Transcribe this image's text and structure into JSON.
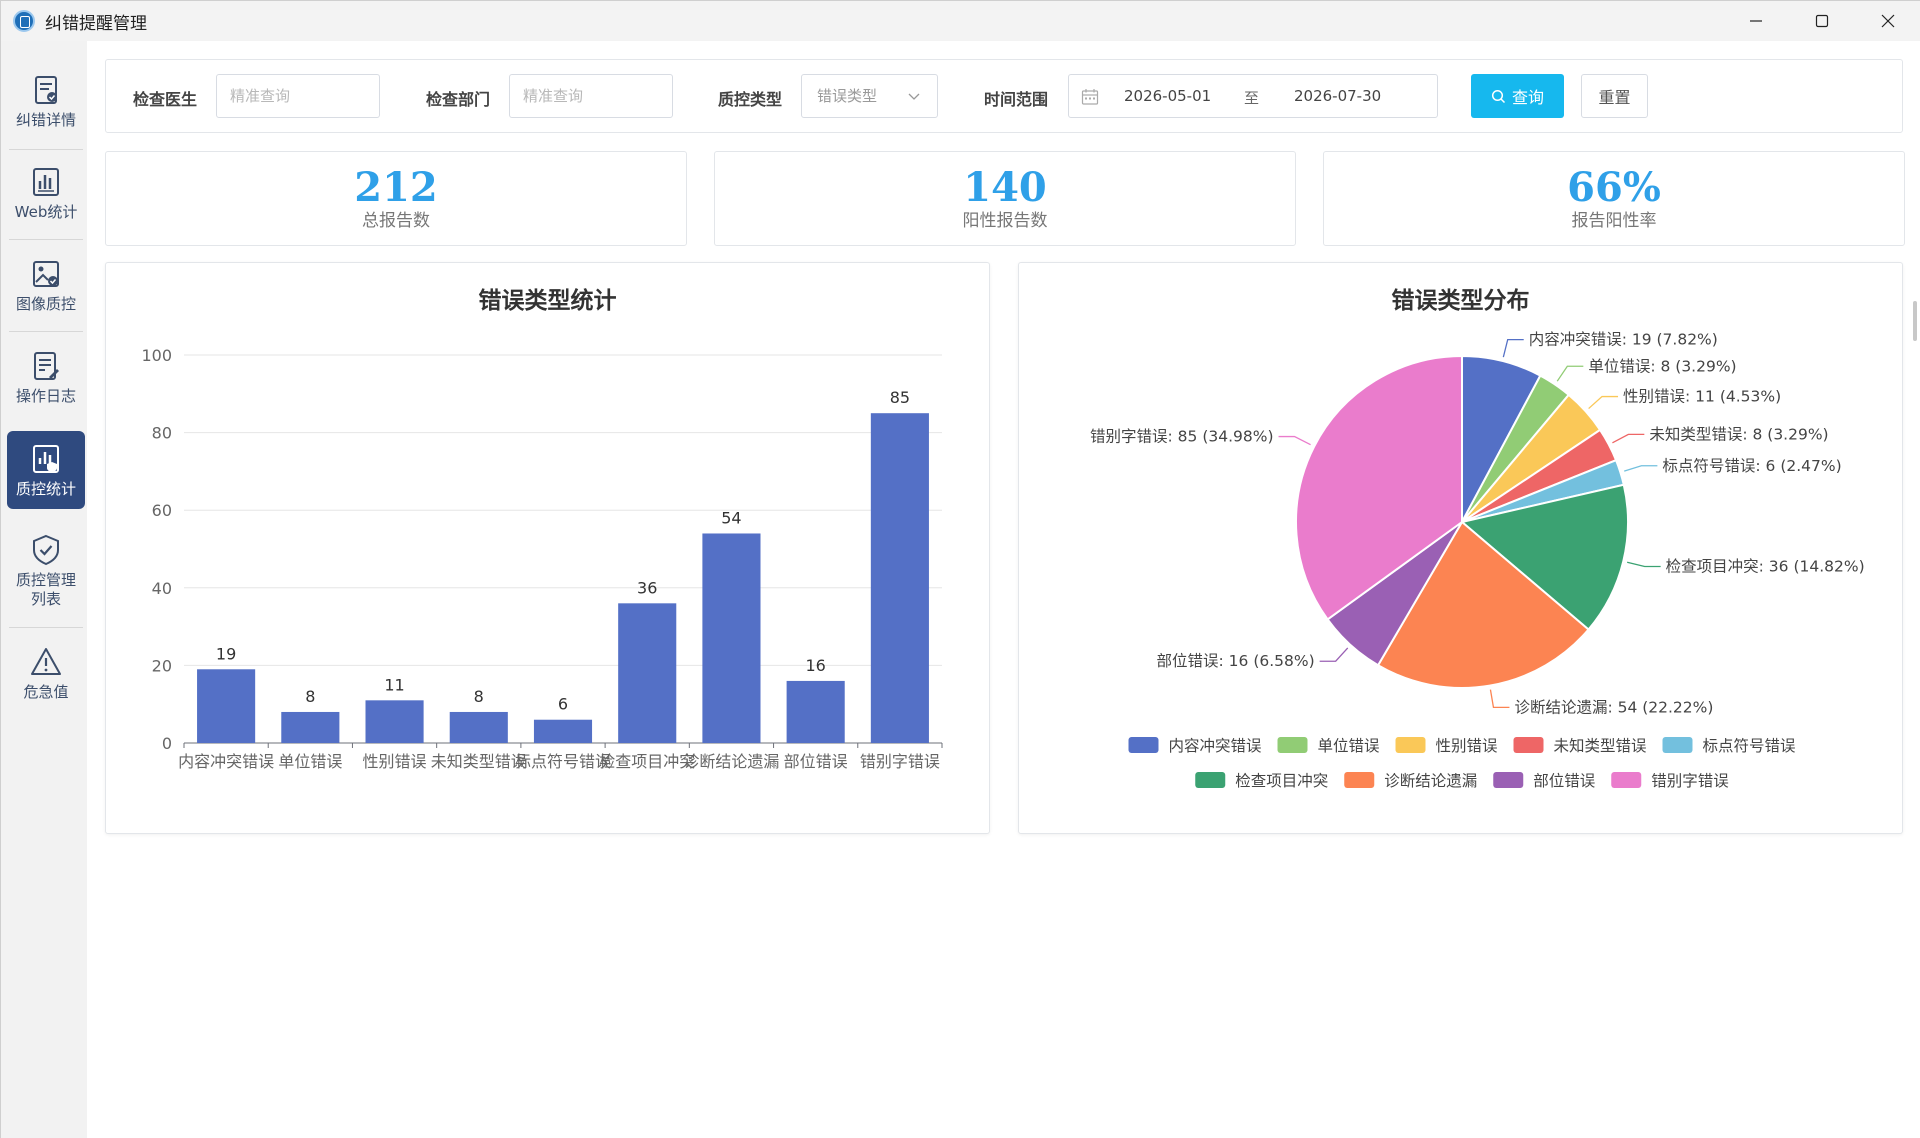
{
  "window": {
    "title": "纠错提醒管理"
  },
  "sidebar": {
    "items": [
      {
        "label": "纠错详情",
        "icon": "document-check-icon"
      },
      {
        "label": "Web统计",
        "icon": "bar-chart-icon"
      },
      {
        "label": "图像质控",
        "icon": "image-check-icon"
      },
      {
        "label": "操作日志",
        "icon": "log-edit-icon"
      },
      {
        "label": "质控统计",
        "icon": "stats-shield-icon",
        "active": true
      },
      {
        "label": "质控管理\n列表",
        "icon": "shield-check-icon"
      },
      {
        "label": "危急值",
        "icon": "warning-icon"
      }
    ]
  },
  "filters": {
    "doctor_label": "检查医生",
    "doctor_placeholder": "精准查询",
    "dept_label": "检查部门",
    "dept_placeholder": "精准查询",
    "qc_type_label": "质控类型",
    "qc_type_value": "错误类型",
    "time_label": "时间范围",
    "date_start": "2026-05-01",
    "date_sep": "至",
    "date_end": "2026-07-30",
    "query_label": "查询",
    "reset_label": "重置"
  },
  "stats": [
    {
      "value": "212",
      "label": "总报告数"
    },
    {
      "value": "140",
      "label": "阳性报告数"
    },
    {
      "value": "66%",
      "label": "报告阳性率"
    }
  ],
  "colors": {
    "bar": "#5470c6",
    "accent": "#16b8ee",
    "stat": "#2fa0e8",
    "nav_active": "#2f4a7f"
  },
  "chart_data": [
    {
      "type": "bar",
      "title": "错误类型统计",
      "categories": [
        "内容冲突错误",
        "单位错误",
        "性别错误",
        "未知类型错误",
        "标点符号错误",
        "检查项目冲突",
        "诊断结论遗漏",
        "部位错误",
        "错别字错误"
      ],
      "values": [
        19,
        8,
        11,
        8,
        6,
        36,
        54,
        16,
        85
      ],
      "ylim": [
        0,
        100
      ],
      "yticks": [
        0,
        20,
        40,
        60,
        80,
        100
      ],
      "grid": true
    },
    {
      "type": "pie",
      "title": "错误类型分布",
      "slices": [
        {
          "name": "内容冲突错误",
          "value": 19,
          "label": "内容冲突错误: 19 (7.82%)",
          "color": "#5470c6"
        },
        {
          "name": "单位错误",
          "value": 8,
          "label": "单位错误: 8 (3.29%)",
          "color": "#91cc75"
        },
        {
          "name": "性别错误",
          "value": 11,
          "label": "性别错误: 11 (4.53%)",
          "color": "#fac858"
        },
        {
          "name": "未知类型错误",
          "value": 8,
          "label": "未知类型错误: 8 (3.29%)",
          "color": "#ee6666"
        },
        {
          "name": "标点符号错误",
          "value": 6,
          "label": "标点符号错误: 6 (2.47%)",
          "color": "#73c0de"
        },
        {
          "name": "检查项目冲突",
          "value": 36,
          "label": "检查项目冲突: 36 (14.82%)",
          "color": "#3ba272"
        },
        {
          "name": "诊断结论遗漏",
          "value": 54,
          "label": "诊断结论遗漏: 54 (22.22%)",
          "color": "#fc8452"
        },
        {
          "name": "部位错误",
          "value": 16,
          "label": "部位错误: 16 (6.58%)",
          "color": "#9a60b4"
        },
        {
          "name": "错别字错误",
          "value": 85,
          "label": "错别字错误: 85 (34.98%)",
          "color": "#ea7ccc"
        }
      ],
      "legend_position": "bottom"
    }
  ]
}
